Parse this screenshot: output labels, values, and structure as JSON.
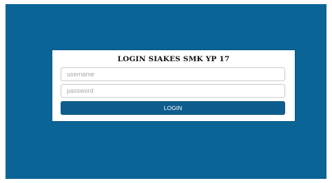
{
  "login": {
    "title": "LOGIN SIAKES SMK YP 17",
    "username_placeholder": "username",
    "username_value": "",
    "password_placeholder": "password",
    "password_value": "",
    "button_label": "LOGIN"
  },
  "colors": {
    "background": "#0a6496",
    "card": "#ffffff",
    "button": "#0f5d8e",
    "button_text": "#ffffff"
  }
}
